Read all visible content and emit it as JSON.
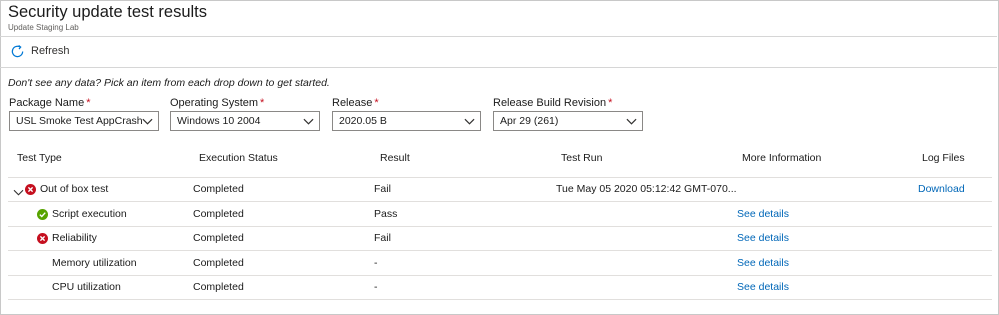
{
  "header": {
    "title": "Security update test results",
    "subtitle": "Update Staging Lab"
  },
  "toolbar": {
    "refresh_label": "Refresh"
  },
  "hint": "Don't see any data? Pick an item from each drop down to get started.",
  "filters": [
    {
      "label": "Package Name",
      "required_mark": "*",
      "value": "USL Smoke Test AppCrash"
    },
    {
      "label": "Operating System",
      "required_mark": "*",
      "value": "Windows 10 2004"
    },
    {
      "label": "Release",
      "required_mark": "*",
      "value": "2020.05 B"
    },
    {
      "label": "Release Build Revision",
      "required_mark": "*",
      "value": "Apr 29 (261)"
    }
  ],
  "table": {
    "columns": [
      "Test Type",
      "Execution Status",
      "Result",
      "Test Run",
      "More Information",
      "Log Files"
    ],
    "rows": [
      {
        "test_type": "Out of box test",
        "status_icon": "error-icon",
        "expandable": true,
        "execution_status": "Completed",
        "result": "Fail",
        "test_run": "Tue May 05 2020 05:12:42 GMT-070...",
        "more_information": "",
        "log_files": "Download"
      },
      {
        "test_type": "Script execution",
        "status_icon": "success-icon",
        "expandable": false,
        "execution_status": "Completed",
        "result": "Pass",
        "test_run": "",
        "more_information": "See details",
        "log_files": ""
      },
      {
        "test_type": "Reliability",
        "status_icon": "error-icon",
        "expandable": false,
        "execution_status": "Completed",
        "result": "Fail",
        "test_run": "",
        "more_information": "See details",
        "log_files": ""
      },
      {
        "test_type": "Memory utilization",
        "status_icon": "",
        "expandable": false,
        "execution_status": "Completed",
        "result": "-",
        "test_run": "",
        "more_information": "See details",
        "log_files": ""
      },
      {
        "test_type": "CPU utilization",
        "status_icon": "",
        "expandable": false,
        "execution_status": "Completed",
        "result": "-",
        "test_run": "",
        "more_information": "See details",
        "log_files": ""
      }
    ]
  },
  "colors": {
    "link": "#0067b8",
    "error": "#c50f1f",
    "success": "#57a300",
    "refresh_icon": "#0078d4"
  }
}
